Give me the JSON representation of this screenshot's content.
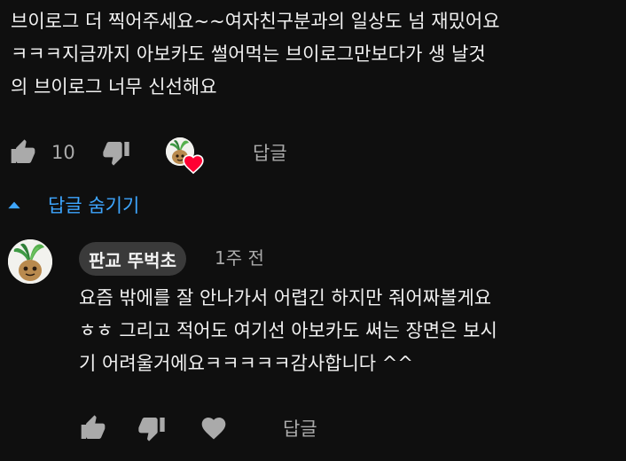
{
  "comment": {
    "text": "브이로그 더 찍어주세요~~여자친구분과의 일상도 넘 재밌어요\nㅋㅋㅋ지금까지 아보카도 썰어먹는 브이로그만보다가 생 날것\n의 브이로그 너무 신선해요",
    "like_count": "10",
    "reply_label": "답글"
  },
  "replies_toggle": {
    "label": "답글 숨기기"
  },
  "reply": {
    "author": "판교 뚜벅초",
    "timestamp": "1주 전",
    "text": "요즘 밖에를 잘 안나가서 어렵긴 하지만 줘어짜볼게요\nㅎㅎ 그리고 적어도 여기선 아보카도 써는 장면은 보시\n기 어려울거에요ㅋㅋㅋㅋㅋ감사합니다 ^^",
    "reply_label": "답글"
  },
  "icons": {
    "like": "thumbs-up-icon",
    "dislike": "thumbs-down-icon",
    "heart": "heart-icon",
    "caret": "caret-up-icon"
  },
  "colors": {
    "background": "#0f0f0f",
    "text": "#f1f1f1",
    "secondary": "#aaaaaa",
    "link": "#3ea6ff",
    "heart": "#ff0033",
    "chip": "#3a3a3a"
  }
}
